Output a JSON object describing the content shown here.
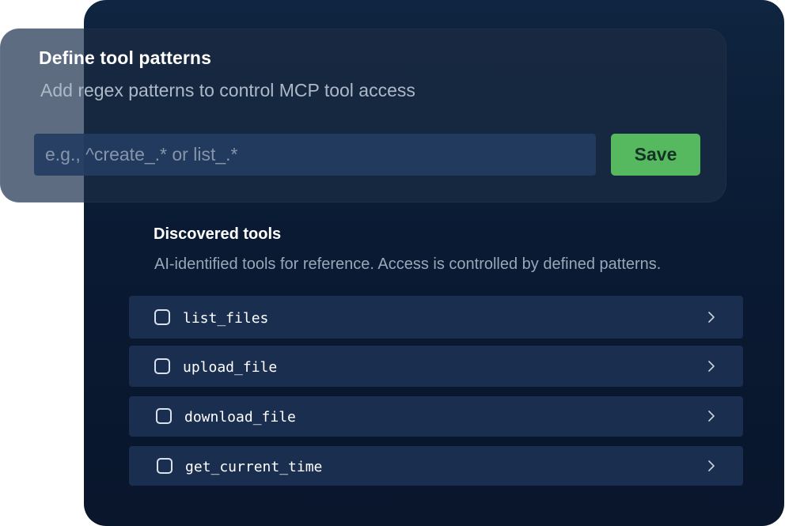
{
  "pattern_card": {
    "title": "Define tool patterns",
    "subtitle": "Add regex patterns to control MCP tool access",
    "input_placeholder": "e.g., ^create_.* or list_.*",
    "input_value": "",
    "save_label": "Save"
  },
  "discovered": {
    "title": "Discovered tools",
    "subtitle": "AI-identified tools for reference. Access is controlled by defined patterns.",
    "tools": [
      {
        "name": "list_files",
        "checked": false
      },
      {
        "name": "upload_file",
        "checked": false
      },
      {
        "name": "download_file",
        "checked": false
      },
      {
        "name": "get_current_time",
        "checked": false
      }
    ]
  },
  "colors": {
    "panel_background": "#0a1a33",
    "row_background": "#1a2e4f",
    "save_button": "#56b95f",
    "save_text": "#143226"
  },
  "icons": {
    "row_chevron": "chevron-right-icon",
    "row_checkbox": "checkbox-icon"
  }
}
